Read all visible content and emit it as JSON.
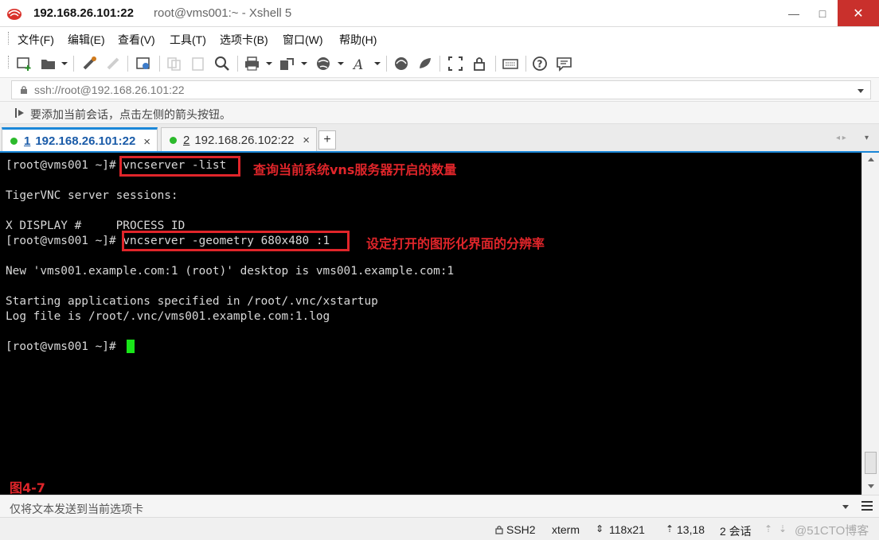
{
  "window": {
    "title_main": "192.168.26.101:22",
    "title_sub": "root@vms001:~ - Xshell 5",
    "minimize": "—",
    "maximize": "□",
    "close": "✕"
  },
  "menu": [
    "文件(F)",
    "编辑(E)",
    "查看(V)",
    "工具(T)",
    "选项卡(B)",
    "窗口(W)",
    "帮助(H)"
  ],
  "address": {
    "value": "ssh://root@192.168.26.101:22"
  },
  "hint": {
    "text": "要添加当前会话，点击左侧的箭头按钮。"
  },
  "tabs": [
    {
      "num": "1",
      "label": "192.168.26.101:22",
      "close": "×",
      "status_color": "#2cba2c"
    },
    {
      "num": "2",
      "label": "192.168.26.102:22",
      "close": "×",
      "status_color": "#2cba2c"
    }
  ],
  "tab_add": "+",
  "tab_nav": {
    "left": "◂ ▸",
    "menu": "▾"
  },
  "terminal": {
    "lines": [
      "[root@vms001 ~]# vncserver -list",
      "",
      "TigerVNC server sessions:",
      "",
      "X DISPLAY #     PROCESS ID",
      "[root@vms001 ~]# vncserver -geometry 680x480 :1",
      "",
      "New 'vms001.example.com:1 (root)' desktop is vms001.example.com:1",
      "",
      "Starting applications specified in /root/.vnc/xstartup",
      "Log file is /root/.vnc/vms001.example.com:1.log",
      "",
      "[root@vms001 ~]# "
    ],
    "annotation_1": "查询当前系统vns服务器开启的数量",
    "annotation_2": "设定打开的图形化界面的分辨率",
    "figure_label": "图4-7",
    "colors": {
      "background": "#000000",
      "text": "#d8d8d8",
      "cursor": "#19e619",
      "annotation": "#e0252a"
    }
  },
  "compose": {
    "placeholder": "仅将文本发送到当前选项卡"
  },
  "status": {
    "protocol": "SSH2",
    "term": "xterm",
    "size": "118x21",
    "cursor_pos": "13,18",
    "sessions": "2 会话",
    "watermark": "@51CTO博客"
  }
}
